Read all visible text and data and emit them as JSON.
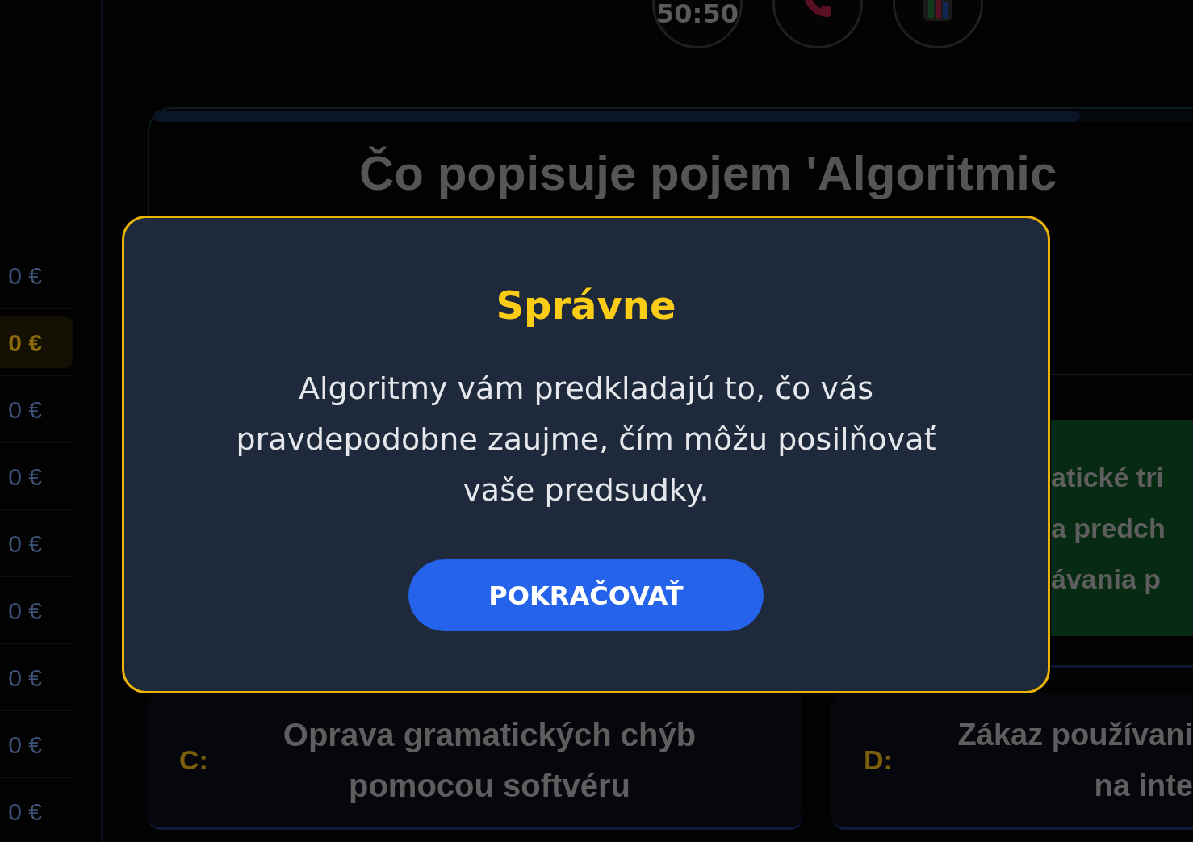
{
  "lifelines": [
    {
      "kind": "fifty_fifty",
      "label": "50:50"
    },
    {
      "kind": "phone"
    },
    {
      "kind": "audience"
    }
  ],
  "prize_ladder": [
    {
      "amount": "0 €",
      "selected": false
    },
    {
      "amount": "0 €",
      "selected": true
    },
    {
      "amount": "0 €",
      "selected": false
    },
    {
      "amount": "0 €",
      "selected": false
    },
    {
      "amount": "0 €",
      "selected": false
    },
    {
      "amount": "0 €",
      "selected": false
    },
    {
      "amount": "0 €",
      "selected": false
    },
    {
      "amount": "0 €",
      "selected": false
    },
    {
      "amount": "0 €",
      "selected": false
    }
  ],
  "question": {
    "timer": {
      "level": 0.89
    },
    "text": "Čo popisuje pojem 'Algoritmic"
  },
  "answers": [
    {
      "text": "atické tri\na predch\návania p",
      "correct": true
    },
    {
      "letter": "C:",
      "text": "Oprava gramatických chýb pomocou softvéru",
      "correct": false
    },
    {
      "letter": "D:",
      "text": "Zákaz používani\nna inte",
      "correct": false
    }
  ],
  "dialog": {
    "title": "Správne",
    "message": "Algoritmy vám predkladajú to, čo vás pravdepodobne zaujme, čím môžu posilňovať vaše predsudky.",
    "button": "POKRAČOVAŤ"
  }
}
